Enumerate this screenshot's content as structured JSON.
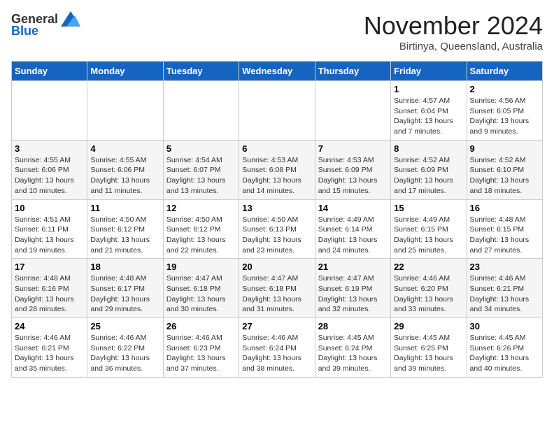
{
  "logo": {
    "general": "General",
    "blue": "Blue"
  },
  "title": "November 2024",
  "subtitle": "Birtinya, Queensland, Australia",
  "headers": [
    "Sunday",
    "Monday",
    "Tuesday",
    "Wednesday",
    "Thursday",
    "Friday",
    "Saturday"
  ],
  "weeks": [
    [
      {
        "day": "",
        "info": ""
      },
      {
        "day": "",
        "info": ""
      },
      {
        "day": "",
        "info": ""
      },
      {
        "day": "",
        "info": ""
      },
      {
        "day": "",
        "info": ""
      },
      {
        "day": "1",
        "info": "Sunrise: 4:57 AM\nSunset: 6:04 PM\nDaylight: 13 hours and 7 minutes."
      },
      {
        "day": "2",
        "info": "Sunrise: 4:56 AM\nSunset: 6:05 PM\nDaylight: 13 hours and 9 minutes."
      }
    ],
    [
      {
        "day": "3",
        "info": "Sunrise: 4:55 AM\nSunset: 6:06 PM\nDaylight: 13 hours and 10 minutes."
      },
      {
        "day": "4",
        "info": "Sunrise: 4:55 AM\nSunset: 6:06 PM\nDaylight: 13 hours and 11 minutes."
      },
      {
        "day": "5",
        "info": "Sunrise: 4:54 AM\nSunset: 6:07 PM\nDaylight: 13 hours and 13 minutes."
      },
      {
        "day": "6",
        "info": "Sunrise: 4:53 AM\nSunset: 6:08 PM\nDaylight: 13 hours and 14 minutes."
      },
      {
        "day": "7",
        "info": "Sunrise: 4:53 AM\nSunset: 6:09 PM\nDaylight: 13 hours and 15 minutes."
      },
      {
        "day": "8",
        "info": "Sunrise: 4:52 AM\nSunset: 6:09 PM\nDaylight: 13 hours and 17 minutes."
      },
      {
        "day": "9",
        "info": "Sunrise: 4:52 AM\nSunset: 6:10 PM\nDaylight: 13 hours and 18 minutes."
      }
    ],
    [
      {
        "day": "10",
        "info": "Sunrise: 4:51 AM\nSunset: 6:11 PM\nDaylight: 13 hours and 19 minutes."
      },
      {
        "day": "11",
        "info": "Sunrise: 4:50 AM\nSunset: 6:12 PM\nDaylight: 13 hours and 21 minutes."
      },
      {
        "day": "12",
        "info": "Sunrise: 4:50 AM\nSunset: 6:12 PM\nDaylight: 13 hours and 22 minutes."
      },
      {
        "day": "13",
        "info": "Sunrise: 4:50 AM\nSunset: 6:13 PM\nDaylight: 13 hours and 23 minutes."
      },
      {
        "day": "14",
        "info": "Sunrise: 4:49 AM\nSunset: 6:14 PM\nDaylight: 13 hours and 24 minutes."
      },
      {
        "day": "15",
        "info": "Sunrise: 4:49 AM\nSunset: 6:15 PM\nDaylight: 13 hours and 25 minutes."
      },
      {
        "day": "16",
        "info": "Sunrise: 4:48 AM\nSunset: 6:15 PM\nDaylight: 13 hours and 27 minutes."
      }
    ],
    [
      {
        "day": "17",
        "info": "Sunrise: 4:48 AM\nSunset: 6:16 PM\nDaylight: 13 hours and 28 minutes."
      },
      {
        "day": "18",
        "info": "Sunrise: 4:48 AM\nSunset: 6:17 PM\nDaylight: 13 hours and 29 minutes."
      },
      {
        "day": "19",
        "info": "Sunrise: 4:47 AM\nSunset: 6:18 PM\nDaylight: 13 hours and 30 minutes."
      },
      {
        "day": "20",
        "info": "Sunrise: 4:47 AM\nSunset: 6:18 PM\nDaylight: 13 hours and 31 minutes."
      },
      {
        "day": "21",
        "info": "Sunrise: 4:47 AM\nSunset: 6:19 PM\nDaylight: 13 hours and 32 minutes."
      },
      {
        "day": "22",
        "info": "Sunrise: 4:46 AM\nSunset: 6:20 PM\nDaylight: 13 hours and 33 minutes."
      },
      {
        "day": "23",
        "info": "Sunrise: 4:46 AM\nSunset: 6:21 PM\nDaylight: 13 hours and 34 minutes."
      }
    ],
    [
      {
        "day": "24",
        "info": "Sunrise: 4:46 AM\nSunset: 6:21 PM\nDaylight: 13 hours and 35 minutes."
      },
      {
        "day": "25",
        "info": "Sunrise: 4:46 AM\nSunset: 6:22 PM\nDaylight: 13 hours and 36 minutes."
      },
      {
        "day": "26",
        "info": "Sunrise: 4:46 AM\nSunset: 6:23 PM\nDaylight: 13 hours and 37 minutes."
      },
      {
        "day": "27",
        "info": "Sunrise: 4:46 AM\nSunset: 6:24 PM\nDaylight: 13 hours and 38 minutes."
      },
      {
        "day": "28",
        "info": "Sunrise: 4:45 AM\nSunset: 6:24 PM\nDaylight: 13 hours and 39 minutes."
      },
      {
        "day": "29",
        "info": "Sunrise: 4:45 AM\nSunset: 6:25 PM\nDaylight: 13 hours and 39 minutes."
      },
      {
        "day": "30",
        "info": "Sunrise: 4:45 AM\nSunset: 6:26 PM\nDaylight: 13 hours and 40 minutes."
      }
    ]
  ]
}
